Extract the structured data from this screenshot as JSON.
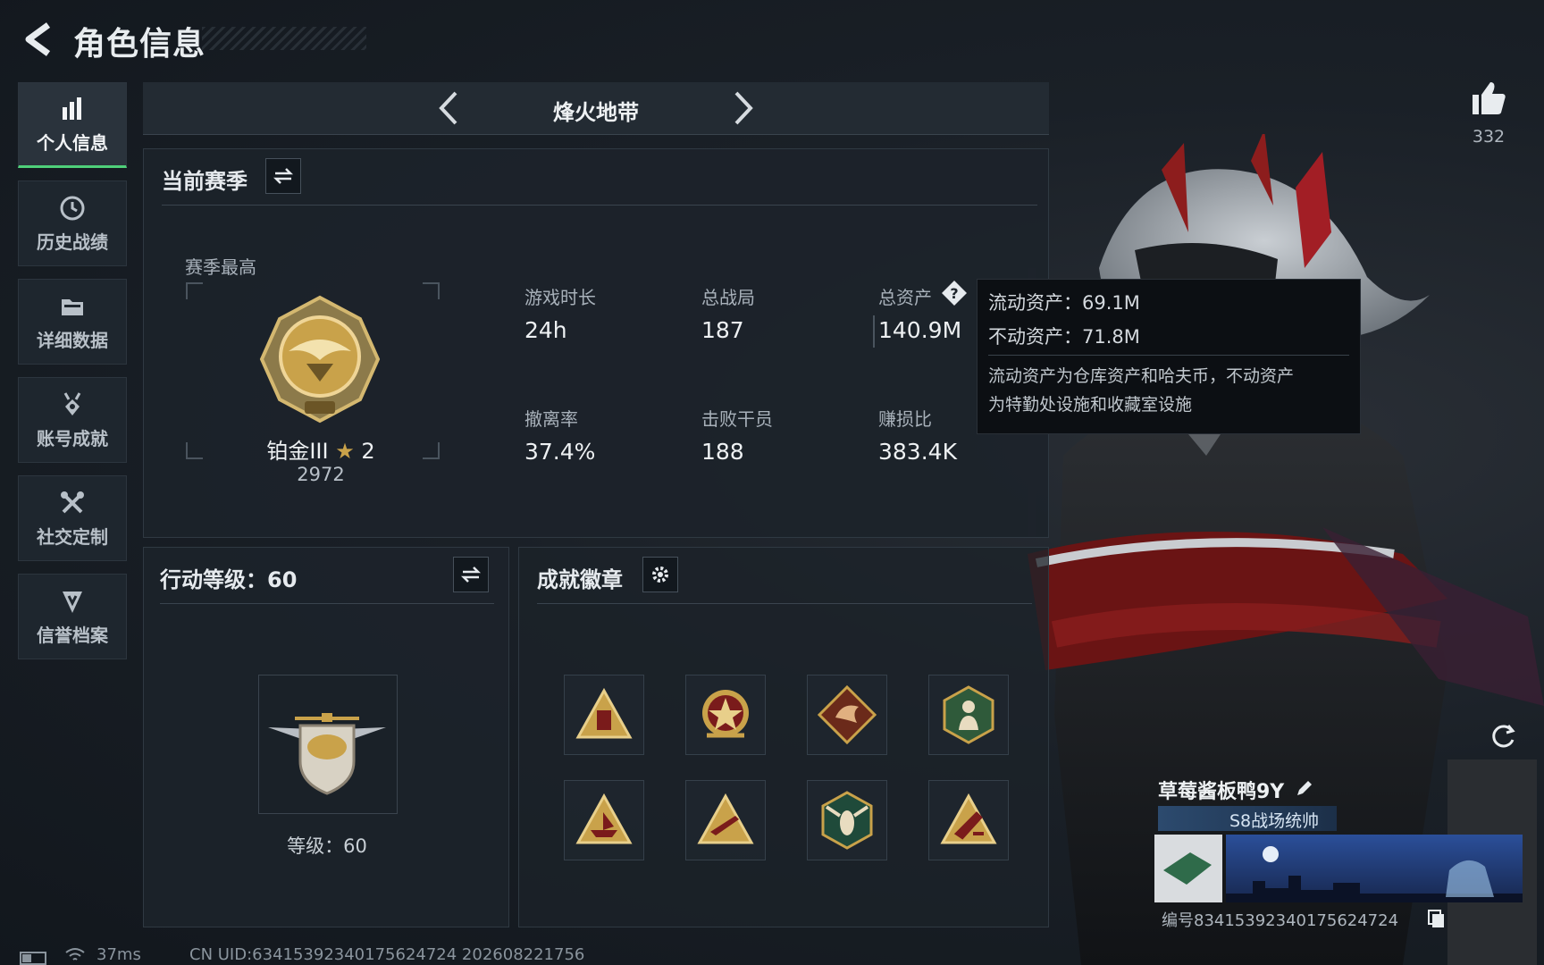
{
  "header": {
    "title": "角色信息"
  },
  "sidebar": {
    "items": [
      {
        "label": "个人信息",
        "icon": "bar-chart-icon",
        "active": true
      },
      {
        "label": "历史战绩",
        "icon": "history-clock-icon"
      },
      {
        "label": "详细数据",
        "icon": "folder-icon"
      },
      {
        "label": "账号成就",
        "icon": "achievement-medal-icon"
      },
      {
        "label": "社交定制",
        "icon": "tools-icon"
      },
      {
        "label": "信誉档案",
        "icon": "credit-shield-icon"
      }
    ]
  },
  "mode": {
    "title": "烽火地带"
  },
  "season": {
    "title": "当前赛季",
    "best_label": "赛季最高",
    "rank_name": "铂金III",
    "rank_stars": "2",
    "rank_score": "2972",
    "stats": [
      {
        "label": "游戏时长",
        "value": "24h"
      },
      {
        "label": "总战局",
        "value": "187"
      },
      {
        "label": "总资产",
        "value": "140.9M"
      },
      {
        "label": "撤离率",
        "value": "37.4%"
      },
      {
        "label": "击败干员",
        "value": "188"
      },
      {
        "label": "赚损比",
        "value": "383.4K"
      }
    ]
  },
  "tooltip": {
    "liquid": "流动资产：69.1M",
    "fixed": "不动资产：71.8M",
    "desc_line1": "流动资产为仓库资产和哈夫币，不动资产",
    "desc_line2": "为特勤处设施和收藏室设施"
  },
  "action_level": {
    "title": "行动等级：60",
    "level_text": "等级：60"
  },
  "achievements": {
    "title": "成就徽章",
    "badges": [
      "triangle-tower-badge",
      "star-emblem-badge",
      "dragon-diamond-badge",
      "soldier-hex-badge",
      "triangle-ship-badge",
      "triangle-gun-badge",
      "hornet-hex-badge",
      "triangle-launcher-badge"
    ]
  },
  "likes": {
    "count": "332"
  },
  "player": {
    "name": "草莓酱板鸭9Y",
    "title": "S8战场统帅",
    "id_text": "编号834153923401756247​24"
  },
  "status_bar": {
    "ping": "37ms",
    "uid": "CN UID:634153923401756247​24  202608221756"
  },
  "colors": {
    "accent_green": "#4fd07a",
    "gold": "#c9a24a",
    "dark_red": "#7a1b1b"
  }
}
